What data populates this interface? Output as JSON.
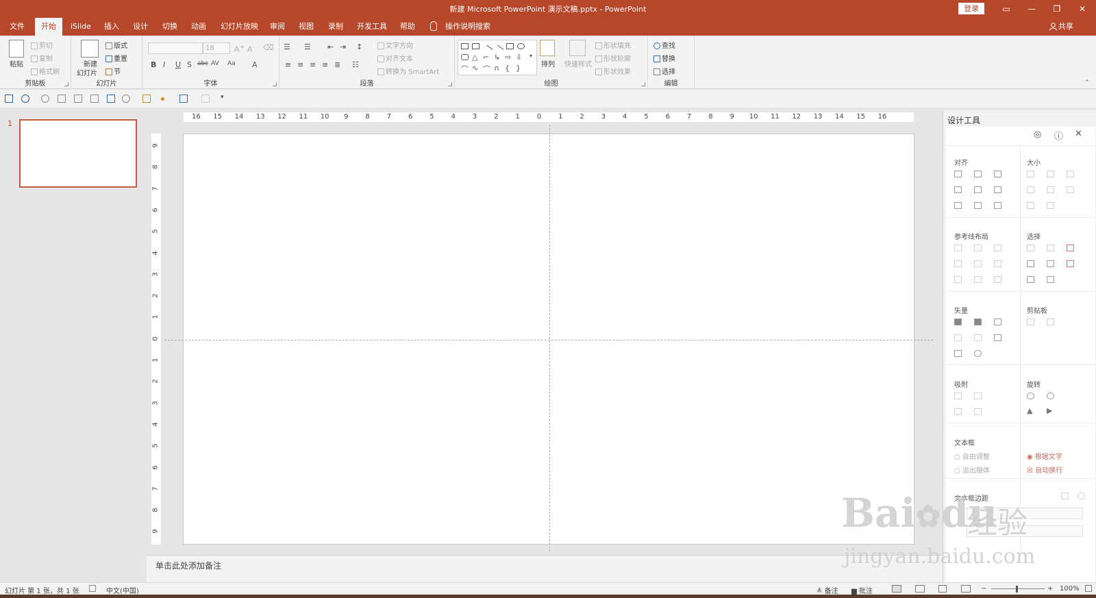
{
  "window": {
    "title": "新建 Microsoft PowerPoint 演示文稿.pptx  -  PowerPoint",
    "login_label": "登录",
    "controls": [
      "▭",
      "—",
      "❐",
      "✕"
    ]
  },
  "tabs": [
    "文件",
    "开始",
    "iSlide",
    "插入",
    "设计",
    "切换",
    "动画",
    "幻灯片放映",
    "审阅",
    "视图",
    "录制",
    "开发工具",
    "帮助"
  ],
  "tell_me": "操作说明搜索",
  "share": "共享",
  "ribbon": {
    "clipboard": {
      "label": "剪贴板",
      "paste": "粘贴",
      "cut": "剪切",
      "copy": "复制",
      "format_painter": "格式刷"
    },
    "slides": {
      "label": "幻灯片",
      "new_slide": "新建",
      "new_slide2": "幻灯片",
      "layout": "版式",
      "reset": "重置",
      "section": "节"
    },
    "font": {
      "label": "字体",
      "font_size": "18"
    },
    "paragraph": {
      "label": "段落",
      "text_direction": "文字方向",
      "align_text": "对齐文本",
      "smartart": "转换为 SmartArt"
    },
    "drawing": {
      "label": "绘图",
      "arrange": "排列",
      "quick_styles": "快速样式",
      "fill": "形状填充",
      "outline": "形状轮廓",
      "effects": "形状效果"
    },
    "editing": {
      "label": "编辑",
      "find": "查找",
      "replace": "替换",
      "select": "选择"
    }
  },
  "thumbnail": {
    "number": "1"
  },
  "ruler": {
    "h": [
      "16",
      "15",
      "14",
      "13",
      "12",
      "11",
      "10",
      "9",
      "8",
      "7",
      "6",
      "5",
      "4",
      "3",
      "2",
      "1",
      "0",
      "1",
      "2",
      "3",
      "4",
      "5",
      "6",
      "7",
      "8",
      "9",
      "10",
      "11",
      "12",
      "13",
      "14",
      "15",
      "16"
    ],
    "v": [
      "9",
      "8",
      "7",
      "6",
      "5",
      "4",
      "3",
      "2",
      "1",
      "0",
      "1",
      "2",
      "3",
      "4",
      "5",
      "6",
      "7",
      "8",
      "9"
    ]
  },
  "notes_placeholder": "单击此处添加备注",
  "design_pane": {
    "title": "设计工具",
    "sections": {
      "align": "对齐",
      "size": "大小",
      "guides": "参考线布局",
      "select": "选择",
      "vector": "矢量",
      "clipboard": "剪贴板",
      "snap": "吸附",
      "rotate": "旋转",
      "textbox": "文本框",
      "margin": "文本框边距"
    },
    "textbox_options": {
      "free": "自由调整",
      "overflow": "溢出缩体",
      "fit_text": "根据文字",
      "auto_wrap": "自动换行"
    }
  },
  "status": {
    "slide_info": "幻灯片 第 1 张，共 1 张",
    "language": "中文(中国)",
    "notes": "备注",
    "comments": "批注",
    "zoom": "100%"
  },
  "watermark": {
    "brand": "Bai",
    "brand2": "du",
    "cn": "经验",
    "url": "jingyan.baidu.com"
  }
}
